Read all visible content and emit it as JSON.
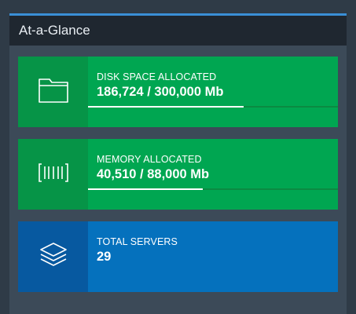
{
  "panel": {
    "title": "At-a-Glance"
  },
  "cards": [
    {
      "icon": "folder-icon",
      "label": "DISK SPACE ALLOCATED",
      "value": "186,724 / 300,000 Mb",
      "progress": 0.6224,
      "color": "#00a651"
    },
    {
      "icon": "memory-icon",
      "label": "MEMORY ALLOCATED",
      "value": "40,510 / 88,000 Mb",
      "progress": 0.4603,
      "color": "#00a651"
    },
    {
      "icon": "layers-icon",
      "label": "TOTAL SERVERS",
      "value": "29",
      "color": "#0571bd"
    }
  ]
}
